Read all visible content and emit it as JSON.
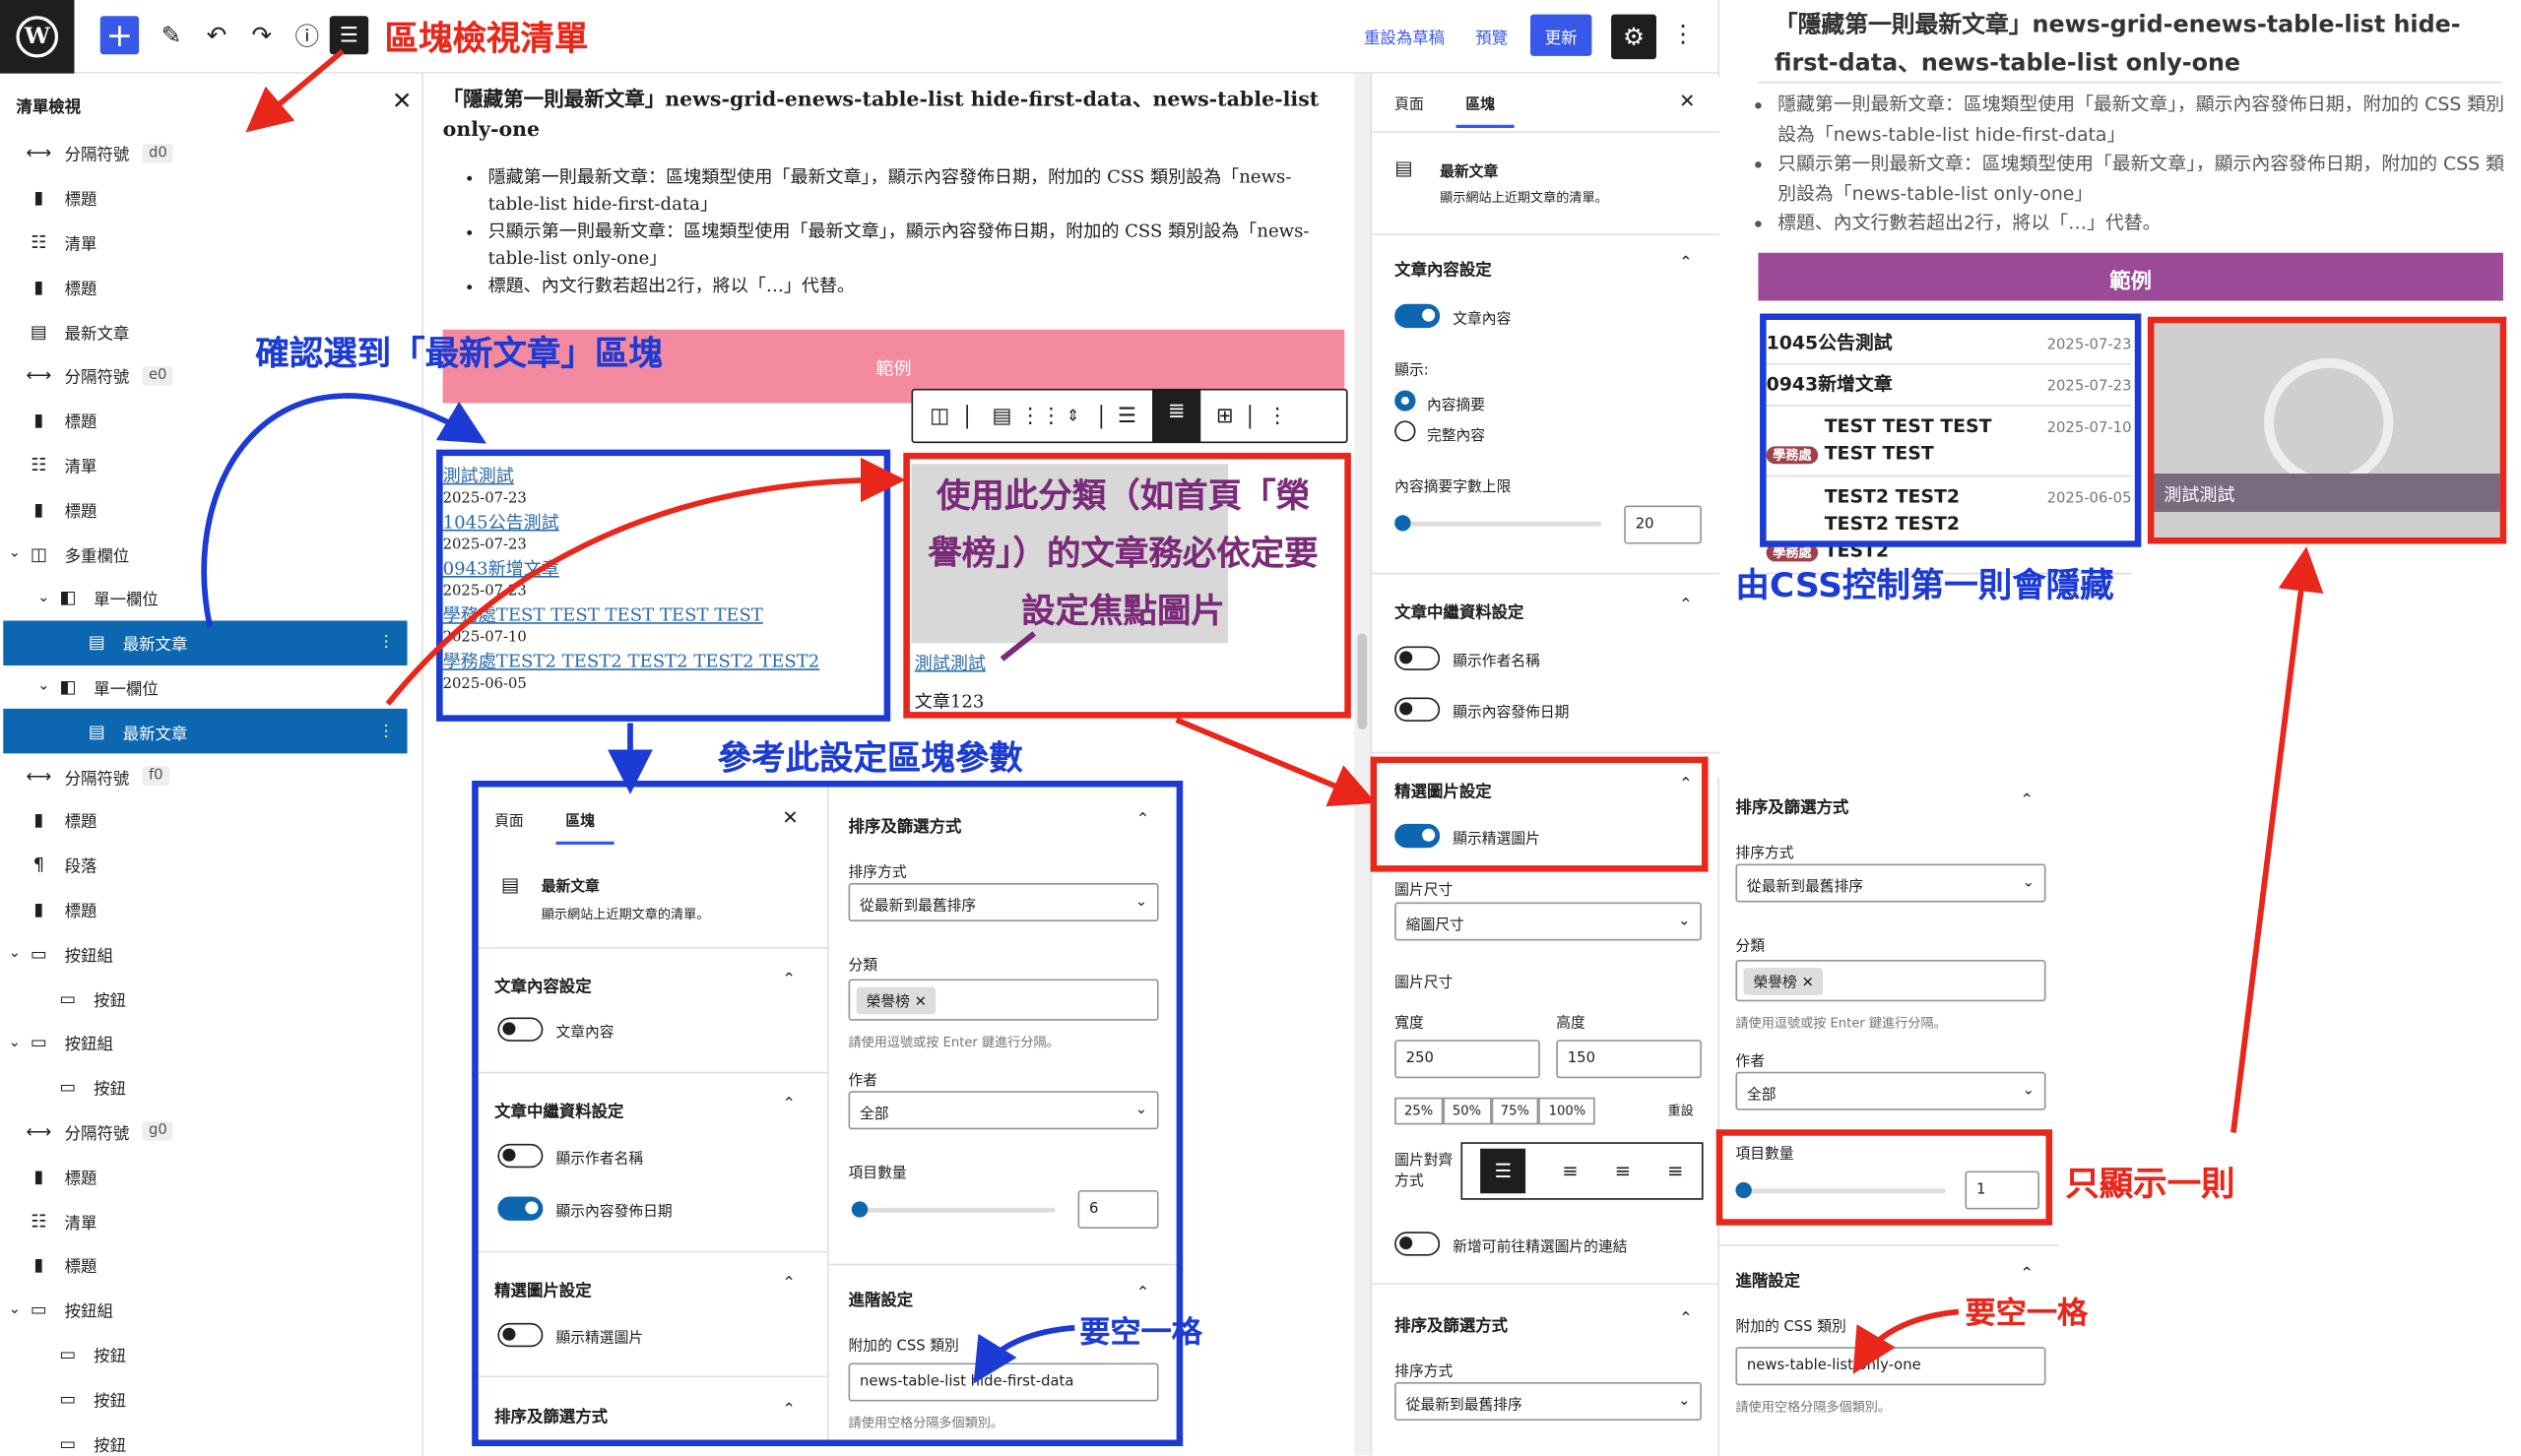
{
  "topbar": {
    "annotation_title": "區塊檢視清單",
    "save_draft": "重設為草稿",
    "preview": "預覽",
    "update": "更新"
  },
  "listview": {
    "title": "清單檢視",
    "rows": [
      {
        "icon": "separator-icon",
        "label": "分隔符號",
        "tag": "d0",
        "indent": 0,
        "chev": ""
      },
      {
        "icon": "bookmark-icon",
        "label": "標題",
        "tag": "",
        "indent": 0,
        "chev": ""
      },
      {
        "icon": "list-icon",
        "label": "清單",
        "tag": "",
        "indent": 0,
        "chev": ""
      },
      {
        "icon": "bookmark-icon",
        "label": "標題",
        "tag": "",
        "indent": 0,
        "chev": ""
      },
      {
        "icon": "posts-icon",
        "label": "最新文章",
        "tag": "",
        "indent": 0,
        "chev": ""
      },
      {
        "icon": "separator-icon",
        "label": "分隔符號",
        "tag": "e0",
        "indent": 0,
        "chev": ""
      },
      {
        "icon": "bookmark-icon",
        "label": "標題",
        "tag": "",
        "indent": 0,
        "chev": ""
      },
      {
        "icon": "list-icon",
        "label": "清單",
        "tag": "",
        "indent": 0,
        "chev": ""
      },
      {
        "icon": "bookmark-icon",
        "label": "標題",
        "tag": "",
        "indent": 0,
        "chev": ""
      },
      {
        "icon": "columns-icon",
        "label": "多重欄位",
        "tag": "",
        "indent": 0,
        "chev": "v"
      },
      {
        "icon": "column-icon",
        "label": "單一欄位",
        "tag": "",
        "indent": 1,
        "chev": "v"
      },
      {
        "icon": "posts-icon",
        "label": "最新文章",
        "tag": "",
        "indent": 2,
        "chev": "",
        "selected": true
      },
      {
        "icon": "column-icon",
        "label": "單一欄位",
        "tag": "",
        "indent": 1,
        "chev": "v"
      },
      {
        "icon": "posts-icon",
        "label": "最新文章",
        "tag": "",
        "indent": 2,
        "chev": "",
        "selected": true
      },
      {
        "icon": "separator-icon",
        "label": "分隔符號",
        "tag": "f0",
        "indent": 0,
        "chev": ""
      },
      {
        "icon": "bookmark-icon",
        "label": "標題",
        "tag": "",
        "indent": 0,
        "chev": ""
      },
      {
        "icon": "paragraph-icon",
        "label": "段落",
        "tag": "",
        "indent": 0,
        "chev": ""
      },
      {
        "icon": "bookmark-icon",
        "label": "標題",
        "tag": "",
        "indent": 0,
        "chev": ""
      },
      {
        "icon": "buttons-icon",
        "label": "按鈕組",
        "tag": "",
        "indent": 0,
        "chev": "v"
      },
      {
        "icon": "button-icon",
        "label": "按鈕",
        "tag": "",
        "indent": 1,
        "chev": ""
      },
      {
        "icon": "buttons-icon",
        "label": "按鈕組",
        "tag": "",
        "indent": 0,
        "chev": "v"
      },
      {
        "icon": "button-icon",
        "label": "按鈕",
        "tag": "",
        "indent": 1,
        "chev": ""
      },
      {
        "icon": "separator-icon",
        "label": "分隔符號",
        "tag": "g0",
        "indent": 0,
        "chev": ""
      },
      {
        "icon": "bookmark-icon",
        "label": "標題",
        "tag": "",
        "indent": 0,
        "chev": ""
      },
      {
        "icon": "list-icon",
        "label": "清單",
        "tag": "",
        "indent": 0,
        "chev": ""
      },
      {
        "icon": "bookmark-icon",
        "label": "標題",
        "tag": "",
        "indent": 0,
        "chev": ""
      },
      {
        "icon": "buttons-icon",
        "label": "按鈕組",
        "tag": "",
        "indent": 0,
        "chev": "v"
      },
      {
        "icon": "button-icon",
        "label": "按鈕",
        "tag": "",
        "indent": 1,
        "chev": ""
      },
      {
        "icon": "button-icon",
        "label": "按鈕",
        "tag": "",
        "indent": 1,
        "chev": ""
      },
      {
        "icon": "button-icon",
        "label": "按鈕",
        "tag": "",
        "indent": 1,
        "chev": ""
      }
    ]
  },
  "canvas": {
    "heading": "「隱藏第一則最新文章」news-grid-enews-table-list hide-first-data、news-table-list only-one",
    "bullets": [
      "隱藏第一則最新文章：區塊類型使用「最新文章」，顯示內容發佈日期，附加的 CSS 類別設為「news-table-list hide-first-data」",
      "只顯示第一則最新文章：區塊類型使用「最新文章」，顯示內容發佈日期，附加的 CSS 類別設為「news-table-list only-one」",
      "標題、內文行數若超出2行，將以「…」代替。"
    ],
    "example_label": "範例",
    "posts": [
      {
        "title": "測試測試",
        "date": "2025-07-23"
      },
      {
        "title": "1045公告測試",
        "date": "2025-07-23"
      },
      {
        "title": "0943新增文章",
        "date": "2025-07-23"
      },
      {
        "title": "學務處TEST TEST TEST TEST TEST",
        "date": "2025-07-10"
      },
      {
        "title": "學務處TEST2 TEST2 TEST2 TEST2 TEST2",
        "date": "2025-06-05"
      }
    ],
    "featured_title": "測試測試",
    "featured_excerpt": "文章123"
  },
  "annotations": {
    "confirm_block": "確認選到「最新文章」區塊",
    "reference": "參考此設定區塊參數",
    "category_note": "使用此分類（如首頁「榮譽榜」）的文章務必依定要設定焦點圖片",
    "css_hide": "由CSS控制第一則會隱藏",
    "only_one": "只顯示一則",
    "space_note": "要空一格"
  },
  "settings": {
    "tab_page": "頁面",
    "tab_block": "區塊",
    "block_name": "最新文章",
    "block_desc": "顯示網站上近期文章的清單。",
    "content_section": "文章內容設定",
    "post_content": "文章內容",
    "show_label": "顯示:",
    "excerpt": "內容摘要",
    "full_content": "完整內容",
    "excerpt_max": "內容摘要字數上限",
    "excerpt_value": "20",
    "meta_section": "文章中繼資料設定",
    "show_author": "顯示作者名稱",
    "show_date": "顯示內容發佈日期",
    "featured_section": "精選圖片設定",
    "show_featured": "顯示精選圖片",
    "image_size_label": "圖片尺寸",
    "image_size_value": "縮圖尺寸",
    "image_dims_label": "圖片尺寸",
    "width_label": "寬度",
    "width_value": "250",
    "height_label": "高度",
    "height_value": "150",
    "pct": [
      "25%",
      "50%",
      "75%",
      "100%"
    ],
    "reset": "重設",
    "align_label": "圖片對齊方式",
    "add_link": "新增可前往精選圖片的連結",
    "sort_section": "排序及篩選方式",
    "sort_label": "排序方式",
    "sort_value": "從最新到最舊排序"
  },
  "panel_a": {
    "tab_page": "頁面",
    "tab_block": "區塊",
    "block_name": "最新文章",
    "block_desc": "顯示網站上近期文章的清單。",
    "content_section": "文章內容設定",
    "post_content": "文章內容",
    "meta_section": "文章中繼資料設定",
    "show_author": "顯示作者名稱",
    "show_date": "顯示內容發佈日期",
    "featured_section": "精選圖片設定",
    "show_featured": "顯示精選圖片",
    "sort_section": "排序及篩選方式"
  },
  "panel_b": {
    "sort_section": "排序及篩選方式",
    "sort_label": "排序方式",
    "sort_value": "從最新到最舊排序",
    "category_label": "分類",
    "category_chip": "榮譽榜",
    "category_help": "請使用逗號或按 Enter 鍵進行分隔。",
    "author_label": "作者",
    "author_value": "全部",
    "count_label": "項目數量",
    "count_value": "6",
    "advanced": "進階設定",
    "css_label": "附加的 CSS 類別",
    "css_value": "news-table-list hide-first-data",
    "css_help": "請使用空格分隔多個類別。"
  },
  "panel_c": {
    "sort_section": "排序及篩選方式",
    "sort_label": "排序方式",
    "sort_value": "從最新到最舊排序",
    "category_label": "分類",
    "category_chip": "榮譽榜",
    "category_help": "請使用逗號或按 Enter 鍵進行分隔。",
    "author_label": "作者",
    "author_value": "全部",
    "count_label": "項目數量",
    "count_value": "1",
    "advanced": "進階設定",
    "css_label": "附加的 CSS 類別",
    "css_value": "news-table-list only-one",
    "css_help": "請使用空格分隔多個類別。"
  },
  "preview": {
    "heading": "「隱藏第一則最新文章」news-grid-enews-table-list hide-first-data、news-table-list only-one",
    "bullets": [
      "隱藏第一則最新文章：區塊類型使用「最新文章」，顯示內容發佈日期，附加的 CSS 類別設為「news-table-list hide-first-data」",
      "只顯示第一則最新文章：區塊類型使用「最新文章」，顯示內容發佈日期，附加的 CSS 類別設為「news-table-list only-one」",
      "標題、內文行數若超出2行，將以「…」代替。"
    ],
    "example_label": "範例",
    "posts": [
      {
        "badge": "",
        "title": "1045公告測試",
        "date": "2025-07-23"
      },
      {
        "badge": "",
        "title": "0943新增文章",
        "date": "2025-07-23"
      },
      {
        "badge": "學務處",
        "title": "TEST TEST TEST TEST TEST",
        "date": "2025-07-10"
      },
      {
        "badge": "學務處",
        "title": "TEST2 TEST2 TEST2 TEST2 TEST2",
        "date": "2025-06-05"
      }
    ],
    "featured_caption": "測試測試"
  },
  "colors": {
    "accent": "#3858e9",
    "selected": "#0d66b0",
    "annot_red": "#e8261a",
    "annot_blue": "#1b3bd4",
    "example_pink": "#f48aa0",
    "example_purple": "#9a4a96"
  }
}
